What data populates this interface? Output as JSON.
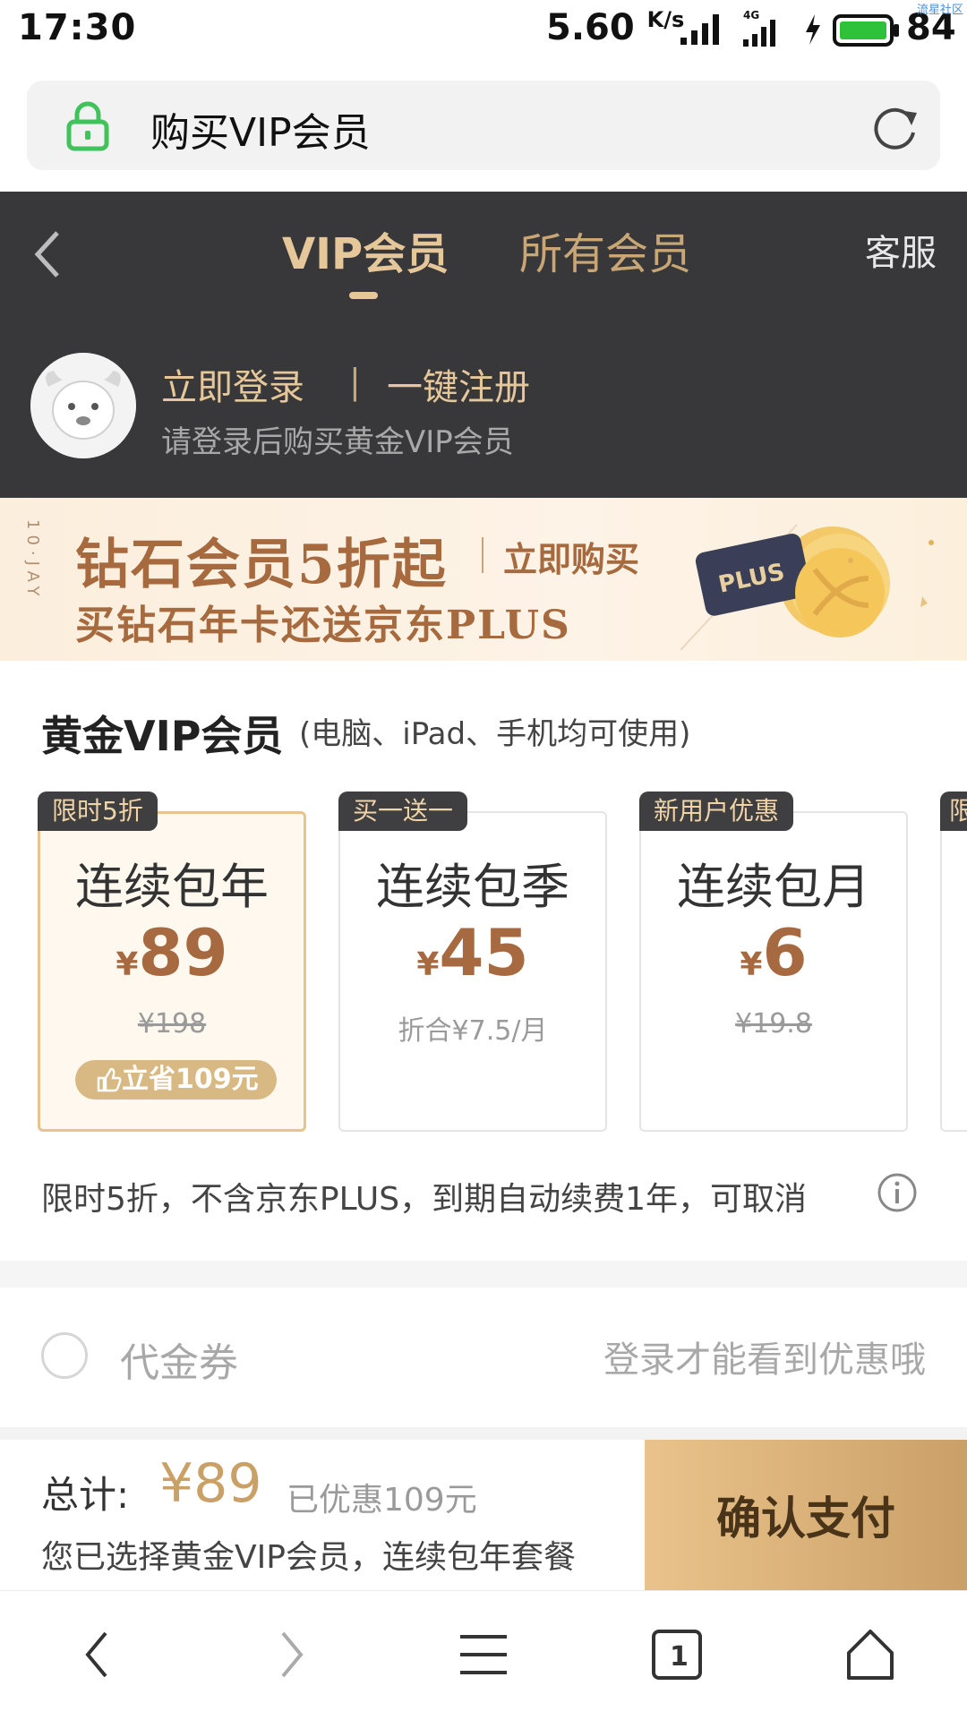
{
  "status_bar": {
    "time": "17:30",
    "speed": "5.60",
    "speed_unit": "K/s",
    "network": "4G",
    "battery": "84",
    "watermark": "流星社区"
  },
  "url_bar": {
    "title": "购买VIP会员",
    "lock_icon": "lock-icon",
    "refresh_icon": "refresh-icon"
  },
  "header": {
    "tabs": [
      {
        "label": "VIP会员",
        "active": true
      },
      {
        "label": "所有会员",
        "active": false
      }
    ],
    "service": "客服",
    "login": "立即登录",
    "separator": "|",
    "register": "一键注册",
    "login_hint": "请登录后购买黄金VIP会员"
  },
  "banner": {
    "line1": "钻石会员5折起",
    "buy": "立即购买",
    "line2": "买钻石年卡还送京东PLUS",
    "card_text": "PLUS",
    "side_text": "10·JAY"
  },
  "section": {
    "title": "黄金VIP会员",
    "subtitle": "(电脑、iPad、手机均可使用)"
  },
  "plans": [
    {
      "tag": "限时5折",
      "name": "连续包年",
      "currency": "¥",
      "price": "89",
      "original": "¥198",
      "save": "立省109元",
      "selected": true
    },
    {
      "tag": "买一送一",
      "name": "连续包季",
      "currency": "¥",
      "price": "45",
      "per_month": "折合¥7.5/月",
      "selected": false
    },
    {
      "tag": "新用户优惠",
      "name": "连续包月",
      "currency": "¥",
      "price": "6",
      "original": "¥19.8",
      "selected": false
    },
    {
      "tag": "限"
    }
  ],
  "notice": "限时5折，不含京东PLUS，到期自动续费1年，可取消",
  "coupon": {
    "label": "代金券",
    "hint": "登录才能看到优惠哦"
  },
  "pay": {
    "total_label": "总计:",
    "total_price": "¥89",
    "discount": "已优惠109元",
    "desc": "您已选择黄金VIP会员，连续包年套餐",
    "confirm": "确认支付"
  },
  "colors": {
    "gold": "#e6c79a",
    "price": "#a76a40",
    "dark": "#38383a",
    "button": "#d9b077"
  }
}
